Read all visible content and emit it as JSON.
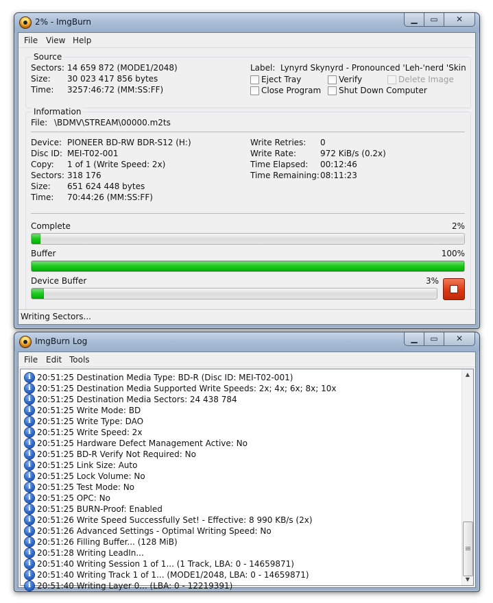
{
  "main_window": {
    "title": "2% - ImgBurn",
    "menu": [
      "File",
      "View",
      "Help"
    ],
    "source": {
      "title": "Source",
      "sectors_label": "Sectors:",
      "sectors_value": "14 659 872 (MODE1/2048)",
      "size_label": "Size:",
      "size_value": "30 023 417 856 bytes",
      "time_label": "Time:",
      "time_value": "3257:46:72 (MM:SS:FF)",
      "label_label": "Label:",
      "label_value": "Lynyrd Skynyrd - Pronounced 'Leh-'nerd 'Skin-'n...",
      "eject_tray": "Eject Tray",
      "verify": "Verify",
      "delete_image": "Delete Image",
      "close_program": "Close Program",
      "shut_down": "Shut Down Computer"
    },
    "information": {
      "title": "Information",
      "file_label": "File:",
      "file_value": "\\BDMV\\STREAM\\00000.m2ts",
      "device_label": "Device:",
      "device_value": "PIONEER BD-RW BDR-S12 (H:)",
      "disc_id_label": "Disc ID:",
      "disc_id_value": "MEI-T02-001",
      "copy_label": "Copy:",
      "copy_value": "1 of 1 (Write Speed: 2x)",
      "sectors_label": "Sectors:",
      "sectors_value": "318 176",
      "size_label": "Size:",
      "size_value": "651 624 448 bytes",
      "time_label": "Time:",
      "time_value": "70:44:26 (MM:SS:FF)",
      "write_retries_label": "Write Retries:",
      "write_retries_value": "0",
      "write_rate_label": "Write Rate:",
      "write_rate_value": "972 KiB/s (0.2x)",
      "time_elapsed_label": "Time Elapsed:",
      "time_elapsed_value": "00:12:46",
      "time_remaining_label": "Time Remaining:",
      "time_remaining_value": "08:11:23"
    },
    "progress": {
      "complete_label": "Complete",
      "complete_text": "2%",
      "complete_fraction": 0.02,
      "buffer_label": "Buffer",
      "buffer_text": "100%",
      "buffer_fraction": 1.0,
      "device_buffer_label": "Device Buffer",
      "device_buffer_text": "3%",
      "device_buffer_fraction": 0.03
    },
    "status": "Writing Sectors..."
  },
  "log_window": {
    "title": "ImgBurn Log",
    "menu": [
      "File",
      "Edit",
      "Tools"
    ],
    "entries": [
      "20:51:25 Destination Media Type: BD-R (Disc ID: MEI-T02-001)",
      "20:51:25 Destination Media Supported Write Speeds: 2x; 4x; 6x; 8x; 10x",
      "20:51:25 Destination Media Sectors: 24 438 784",
      "20:51:25 Write Mode: BD",
      "20:51:25 Write Type: DAO",
      "20:51:25 Write Speed: 2x",
      "20:51:25 Hardware Defect Management Active: No",
      "20:51:25 BD-R Verify Not Required: No",
      "20:51:25 Link Size: Auto",
      "20:51:25 Lock Volume: No",
      "20:51:25 Test Mode: No",
      "20:51:25 OPC: No",
      "20:51:25 BURN-Proof: Enabled",
      "20:51:26 Write Speed Successfully Set! - Effective: 8 990 KB/s (2x)",
      "20:51:26 Advanced Settings - Optimal Writing Speed: No",
      "20:51:26 Filling Buffer... (128 MiB)",
      "20:51:28 Writing LeadIn...",
      "20:51:40 Writing Session 1 of 1... (1 Track, LBA: 0 - 14659871)",
      "20:51:40 Writing Track 1 of 1... (MODE1/2048, LBA: 0 - 14659871)",
      "20:51:40 Writing Layer 0... (LBA: 0 - 12219391)"
    ]
  },
  "icons": {
    "app": "imgburn-disc-icon",
    "log_entry": "info-icon",
    "stop": "stop-icon"
  },
  "colors": {
    "progress_green": "#1bc81b",
    "stop_red": "#d83a12",
    "info_blue": "#2f69c9"
  }
}
